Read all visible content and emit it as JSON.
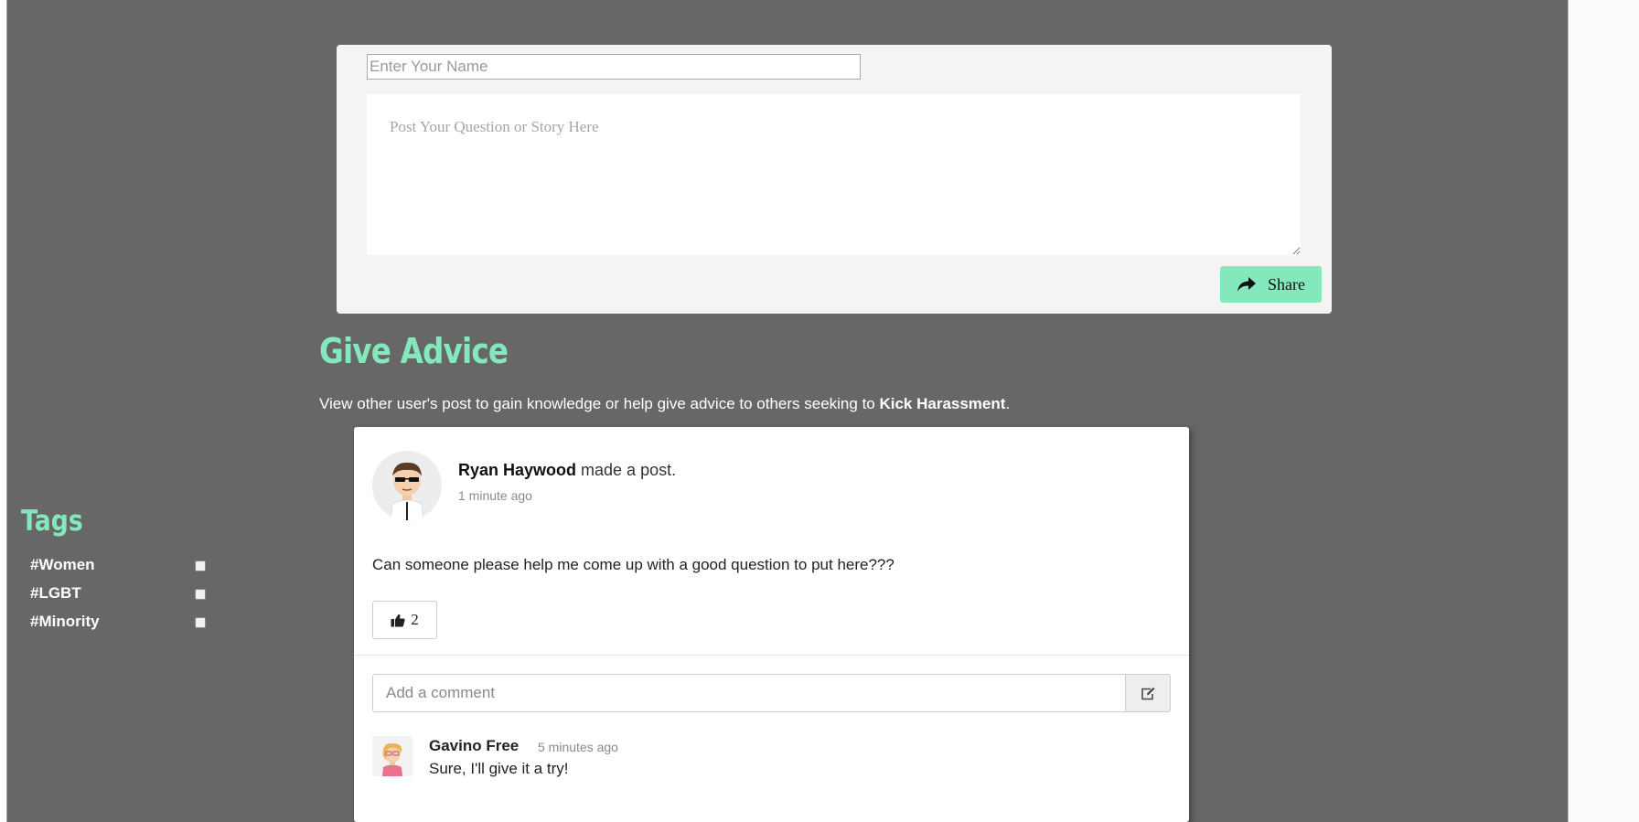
{
  "post_form": {
    "name_placeholder": "Enter Your Name",
    "story_placeholder": "Post Your Question or Story Here",
    "share_label": "Share"
  },
  "advice": {
    "title": "Give Advice",
    "description_prefix": "View other user's post to gain knowledge or help give advice to others seeking to ",
    "description_bold": "Kick Harassment",
    "description_suffix": "."
  },
  "tags": {
    "title": "Tags",
    "items": [
      {
        "label": "#Women",
        "checked": false
      },
      {
        "label": "#LGBT",
        "checked": false
      },
      {
        "label": "#Minority",
        "checked": false
      }
    ]
  },
  "post": {
    "author": "Ryan Haywood",
    "action": " made a post.",
    "time": "1 minute ago",
    "body": "Can someone please help me come up with a good question to put here???",
    "likes": "2",
    "comment_placeholder": "Add a comment",
    "comments": [
      {
        "author": "Gavino Free",
        "time": "5 minutes ago",
        "text": "Sure, I'll give it a try!"
      }
    ]
  },
  "icons": {
    "share": "share-arrow-icon",
    "like": "thumbs-up-icon",
    "comment_submit": "edit-icon"
  },
  "colors": {
    "accent": "#84e8bc",
    "page_background": "#676767"
  }
}
